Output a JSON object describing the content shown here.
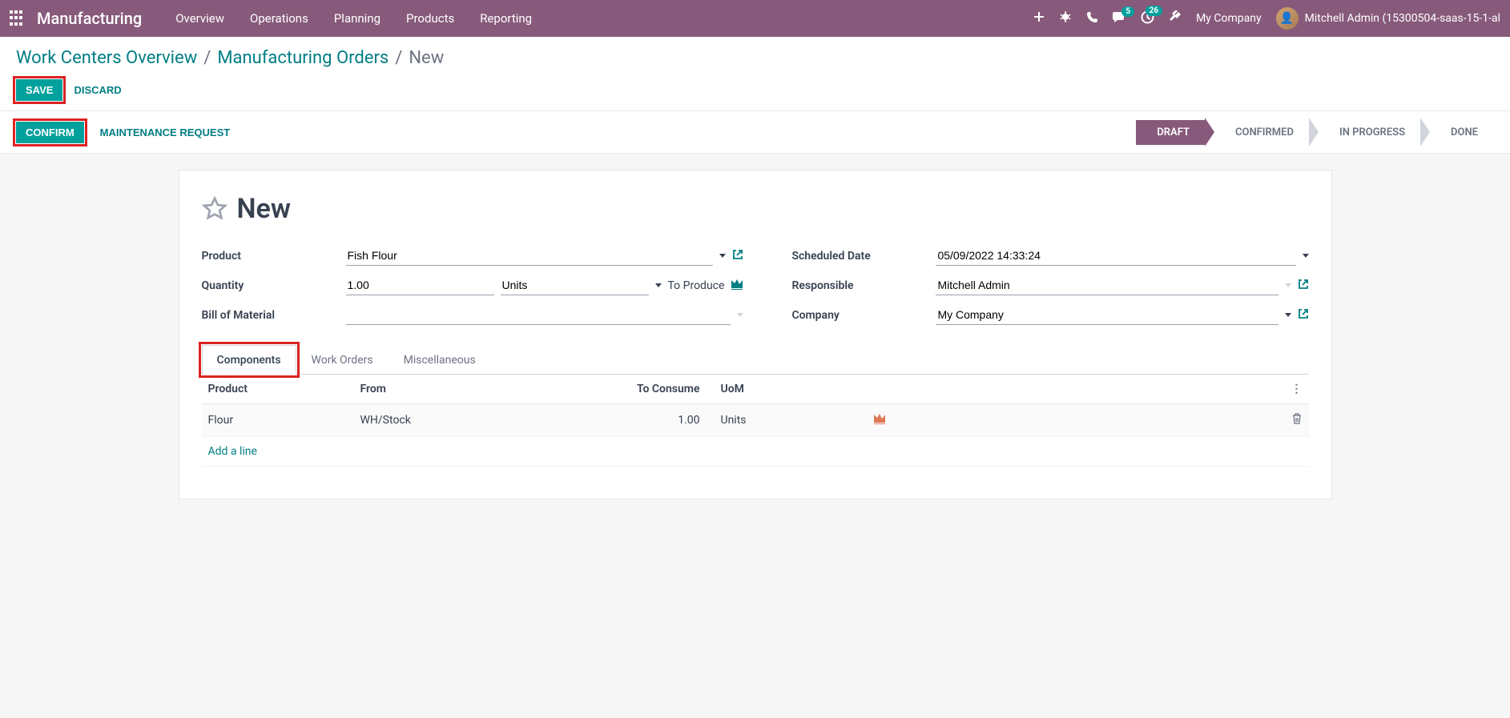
{
  "nav": {
    "brand": "Manufacturing",
    "menu": [
      "Overview",
      "Operations",
      "Planning",
      "Products",
      "Reporting"
    ],
    "chat_badge": "5",
    "activity_badge": "26",
    "company": "My Company",
    "user": "Mitchell Admin (15300504-saas-15-1-al"
  },
  "breadcrumb": {
    "a": "Work Centers Overview",
    "b": "Manufacturing Orders",
    "current": "New"
  },
  "actions": {
    "save": "SAVE",
    "discard": "DISCARD"
  },
  "statusbar": {
    "confirm": "CONFIRM",
    "maint": "MAINTENANCE REQUEST",
    "steps": [
      "DRAFT",
      "CONFIRMED",
      "IN PROGRESS",
      "DONE"
    ]
  },
  "form": {
    "title": "New",
    "labels": {
      "product": "Product",
      "quantity": "Quantity",
      "bom": "Bill of Material",
      "scheduled": "Scheduled Date",
      "responsible": "Responsible",
      "company": "Company",
      "to_produce": "To Produce"
    },
    "values": {
      "product": "Fish Flour",
      "quantity": "1.00",
      "uom": "Units",
      "bom": "",
      "scheduled": "05/09/2022 14:33:24",
      "responsible": "Mitchell Admin",
      "company": "My Company"
    }
  },
  "tabs": [
    "Components",
    "Work Orders",
    "Miscellaneous"
  ],
  "table": {
    "headers": {
      "product": "Product",
      "from": "From",
      "to_consume": "To Consume",
      "uom": "UoM"
    },
    "rows": [
      {
        "product": "Flour",
        "from": "WH/Stock",
        "to_consume": "1.00",
        "uom": "Units"
      }
    ],
    "add_line": "Add a line"
  }
}
